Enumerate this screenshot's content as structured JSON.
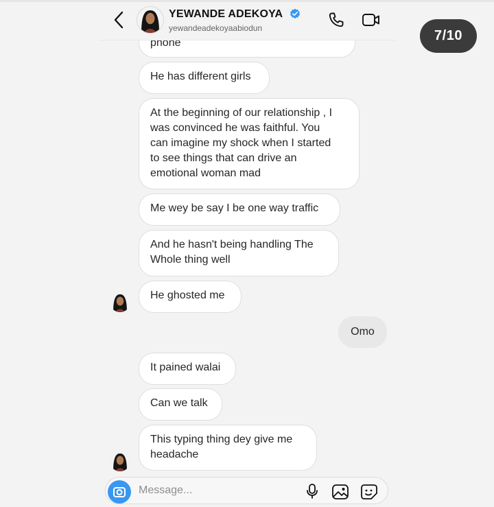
{
  "header": {
    "name": "YEWANDE ADEKOYA",
    "username": "yewandeadekoyaabiodun"
  },
  "counter": "7/10",
  "messages": [
    {
      "text": "phone",
      "from": "them"
    },
    {
      "text": "He has different girls",
      "from": "them"
    },
    {
      "text": "At the beginning of our relationship , I\nwas convinced he was faithful. You\ncan imagine my shock when I started\nto see things that can drive an\nemotional woman mad",
      "from": "them"
    },
    {
      "text": "Me wey be say I be one way traffic",
      "from": "them"
    },
    {
      "text": "And he hasn't being handling The\nWhole thing well",
      "from": "them"
    },
    {
      "text": "He ghosted me",
      "from": "them"
    },
    {
      "text": "Omo",
      "from": "me"
    },
    {
      "text": "It pained walai",
      "from": "them"
    },
    {
      "text": "Can we talk",
      "from": "them"
    },
    {
      "text": "This typing thing dey give me\nheadache",
      "from": "them"
    }
  ],
  "composer": {
    "placeholder": "Message..."
  },
  "colors": {
    "verified": "#3897f0",
    "camera_button": "#3897f0",
    "counter_bg": "#3b3b3b",
    "outgoing_bubble": "#e8e8e8"
  },
  "icons": [
    "back-icon",
    "verified-icon",
    "call-icon",
    "video-call-icon",
    "camera-icon",
    "mic-icon",
    "gallery-icon",
    "sticker-icon"
  ]
}
